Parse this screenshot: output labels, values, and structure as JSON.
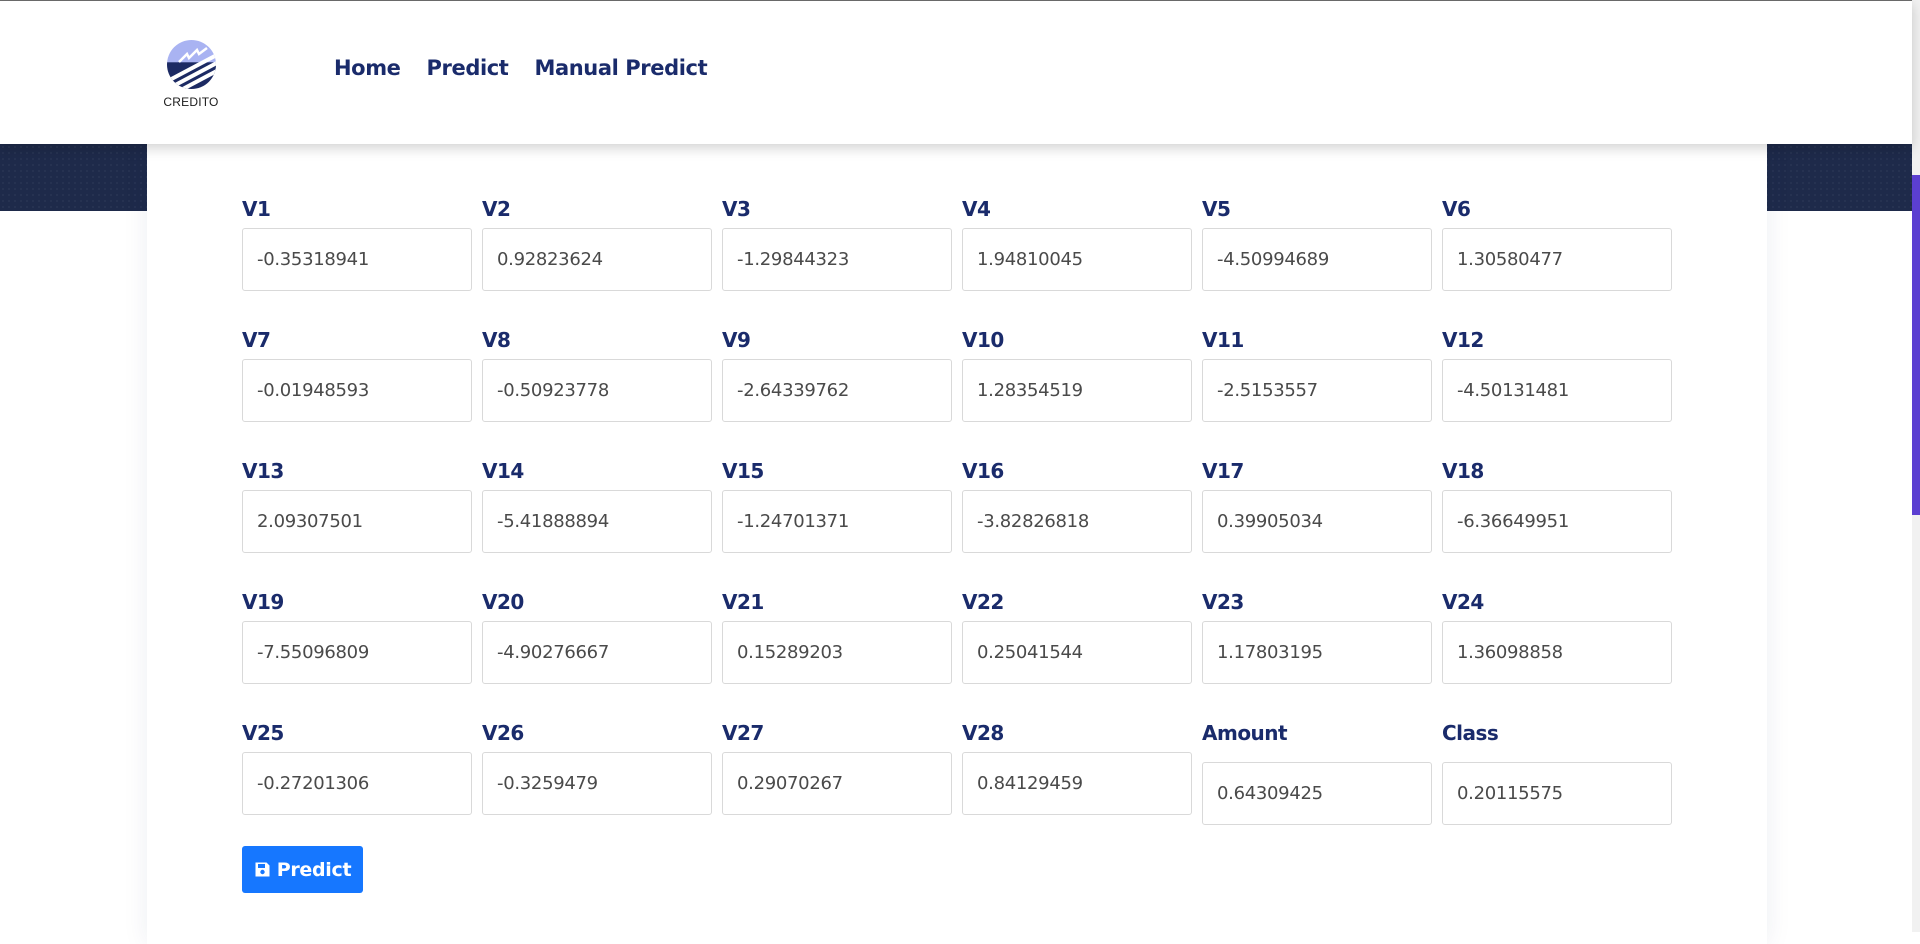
{
  "brand": {
    "name": "CREDITO"
  },
  "nav": [
    {
      "label": "Home"
    },
    {
      "label": "Predict"
    },
    {
      "label": "Manual Predict"
    }
  ],
  "form": {
    "fields": [
      {
        "label": "V1",
        "value": "-0.35318941"
      },
      {
        "label": "V2",
        "value": "0.92823624"
      },
      {
        "label": "V3",
        "value": "-1.29844323"
      },
      {
        "label": "V4",
        "value": "1.94810045"
      },
      {
        "label": "V5",
        "value": "-4.50994689"
      },
      {
        "label": "V6",
        "value": "1.30580477"
      },
      {
        "label": "V7",
        "value": "-0.01948593"
      },
      {
        "label": "V8",
        "value": "-0.50923778"
      },
      {
        "label": "V9",
        "value": "-2.64339762"
      },
      {
        "label": "V10",
        "value": "1.28354519"
      },
      {
        "label": "V11",
        "value": "-2.5153557"
      },
      {
        "label": "V12",
        "value": "-4.50131481"
      },
      {
        "label": "V13",
        "value": "2.09307501"
      },
      {
        "label": "V14",
        "value": "-5.41888894"
      },
      {
        "label": "V15",
        "value": "-1.24701371"
      },
      {
        "label": "V16",
        "value": "-3.82826818"
      },
      {
        "label": "V17",
        "value": "0.39905034"
      },
      {
        "label": "V18",
        "value": "-6.36649951"
      },
      {
        "label": "V19",
        "value": "-7.55096809"
      },
      {
        "label": "V20",
        "value": "-4.90276667"
      },
      {
        "label": "V21",
        "value": "0.15289203"
      },
      {
        "label": "V22",
        "value": "0.25041544"
      },
      {
        "label": "V23",
        "value": "1.17803195"
      },
      {
        "label": "V24",
        "value": "1.36098858"
      },
      {
        "label": "V25",
        "value": "-0.27201306"
      },
      {
        "label": "V26",
        "value": "-0.3259479"
      },
      {
        "label": "V27",
        "value": "0.29070267"
      },
      {
        "label": "V28",
        "value": "0.84129459"
      },
      {
        "label": "Amount",
        "value": "0.64309425"
      },
      {
        "label": "Class",
        "value": "0.20115575"
      }
    ],
    "submit_label": "Predict",
    "submit_icon": "save-icon",
    "accent_color": "#1677ff"
  }
}
